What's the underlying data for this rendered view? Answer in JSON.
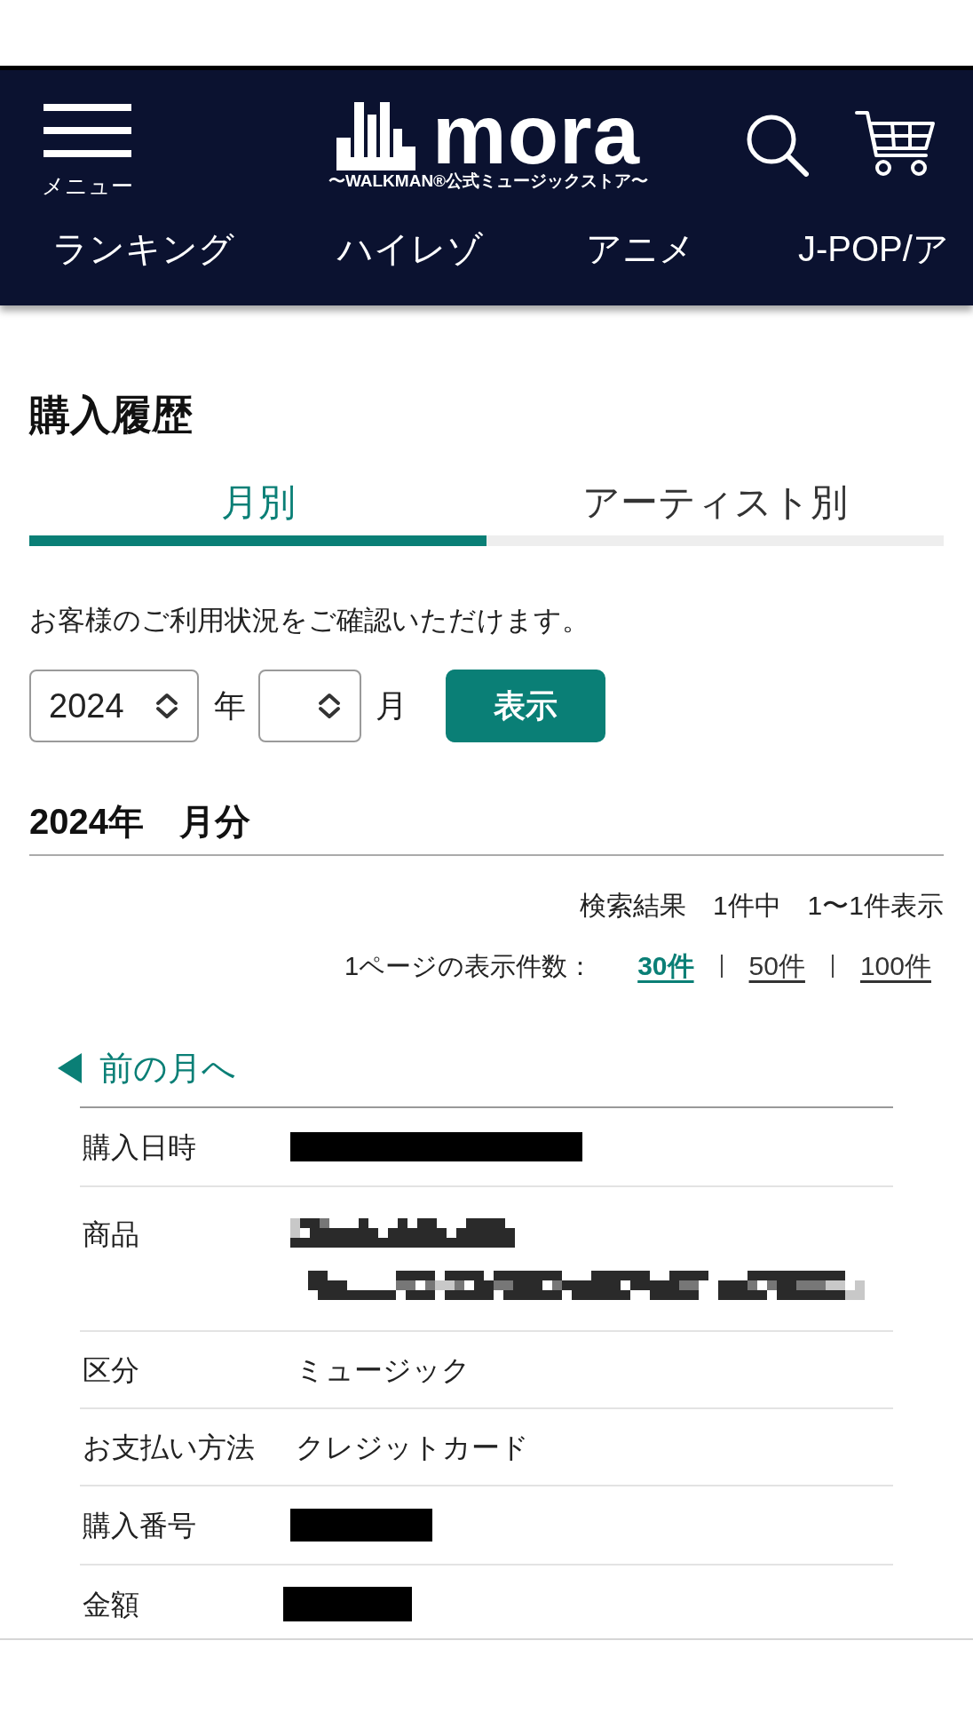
{
  "header": {
    "menu_label": "メニュー",
    "logo": {
      "wordmark": "mora",
      "tagline": "〜WALKMAN®公式ミュージックストア〜"
    },
    "nav": [
      "ランキング",
      "ハイレゾ",
      "アニメ",
      "J-POP/ア"
    ]
  },
  "page_title": "購入履歴",
  "tabs": [
    {
      "label": "月別",
      "selected": true
    },
    {
      "label": "アーティスト別",
      "selected": false
    }
  ],
  "description": "お客様のご利用状況をご確認いただけます。",
  "filter": {
    "year": {
      "value": "2024"
    },
    "year_unit": "年",
    "month_unit": "月",
    "submit": "表示"
  },
  "section_title": "2024年　月分",
  "results": {
    "summary": "検索結果　1件中　1〜1件表示",
    "per_page_label": "1ページの表示件数：",
    "per_page_options": [
      {
        "label": "30件",
        "selected": true
      },
      {
        "label": "50件",
        "selected": false
      },
      {
        "label": "100件",
        "selected": false
      }
    ]
  },
  "prev_month": "前の月へ",
  "purchase_rows": [
    {
      "label": "購入日時",
      "kind": "redacted"
    },
    {
      "label": "商品",
      "kind": "mosaic"
    },
    {
      "label": "区分",
      "kind": "text",
      "value": "ミュージック"
    },
    {
      "label": "お支払い方法",
      "kind": "text",
      "value": "クレジットカード"
    },
    {
      "label": "購入番号",
      "kind": "redacted"
    },
    {
      "label": "金額",
      "kind": "redacted"
    }
  ]
}
